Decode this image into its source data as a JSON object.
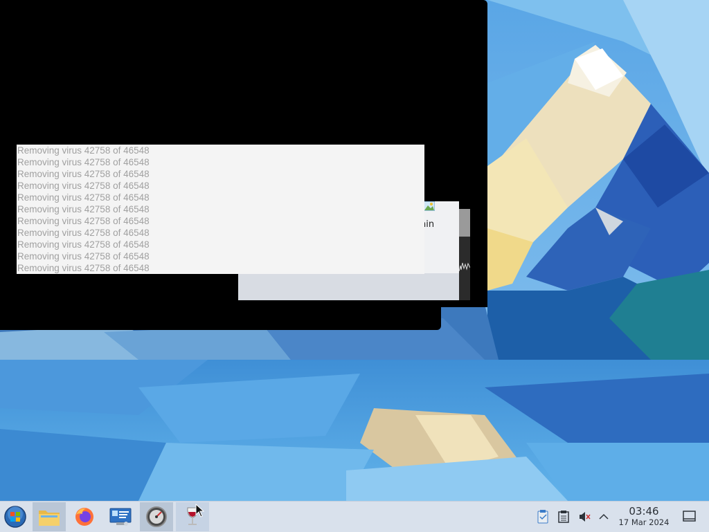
{
  "desktop": {
    "virus_panel": {
      "lines": [
        "Removing virus 42758 of 46548",
        "Removing virus 42758 of 46548",
        "Removing virus 42758 of 46548",
        "Removing virus 42758 of 46548",
        "Removing virus 42758 of 46548",
        "Removing virus 42758 of 46548",
        "Removing virus 42758 of 46548",
        "Removing virus 42758 of 46548",
        "Removing virus 42758 of 46548",
        "Removing virus 42758 of 46548",
        "Removing virus 42758 of 46548"
      ]
    },
    "background_dialog": {
      "partial_text": "hin"
    }
  },
  "taskbar": {
    "start_button": {
      "icon": "start-orb-icon"
    },
    "apps": [
      {
        "name": "file-manager",
        "icon": "folder-icon",
        "state": "active"
      },
      {
        "name": "firefox",
        "icon": "firefox-icon",
        "state": "normal"
      },
      {
        "name": "control-panel",
        "icon": "monitor-icon",
        "state": "normal"
      },
      {
        "name": "speedometer",
        "icon": "gauge-icon",
        "state": "active"
      },
      {
        "name": "wine",
        "icon": "wine-glass-icon",
        "state": "hover"
      }
    ],
    "tray": {
      "icons": [
        "clipboard-notes-icon",
        "clipboard-icon",
        "volume-muted-icon",
        "chevron-up-icon"
      ]
    },
    "clock": {
      "time": "03:46",
      "date": "17 Mar 2024"
    },
    "colors": {
      "taskbar_bg": "#d9e1ec",
      "active_bg": "#b9c6d6"
    }
  }
}
